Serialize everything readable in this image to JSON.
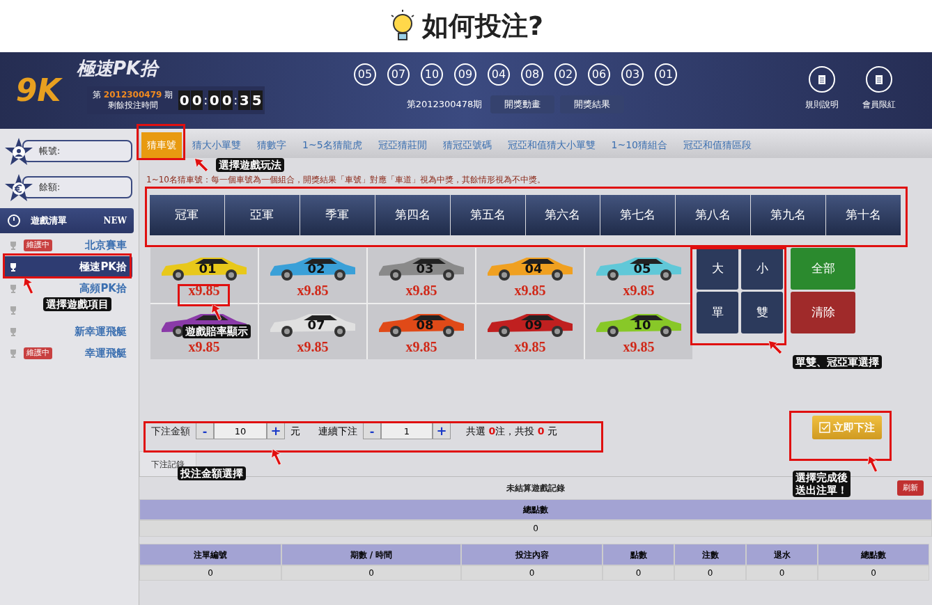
{
  "page_title": "如何投注?",
  "header": {
    "logo": "9K",
    "game_title": "極速PK拾",
    "period_prefix": "第",
    "period": "2012300479",
    "period_suffix": "期",
    "countdown_label": "剩餘投注時間",
    "countdown": [
      "0",
      "0",
      ":",
      "0",
      "0",
      ":",
      "3",
      "5"
    ],
    "draw_numbers": [
      "05",
      "07",
      "10",
      "09",
      "04",
      "08",
      "02",
      "06",
      "03",
      "01"
    ],
    "last_period": "第2012300478期",
    "buttons": [
      "開獎動畫",
      "開獎結果"
    ],
    "links": [
      "規則說明",
      "會員限紅"
    ]
  },
  "sidebar": {
    "fields": [
      {
        "label": "帳號:",
        "kind": "user"
      },
      {
        "label": "餘額:",
        "kind": "euro"
      }
    ],
    "menu_title": "遊戲清單",
    "menu_badge": "NEW",
    "games": [
      {
        "name": "北京賽車",
        "badge": "維護中",
        "selected": false
      },
      {
        "name": "極速PK拾",
        "selected": true
      },
      {
        "name": "高頻PK拾",
        "selected": false
      },
      {
        "selected": false
      },
      {
        "name": "新幸運飛艇",
        "selected": false
      },
      {
        "name": "幸運飛艇",
        "badge": "維護中",
        "selected": false
      }
    ]
  },
  "tabs": [
    {
      "label": "猜車號",
      "selected": true
    },
    {
      "label": "猜大小單雙",
      "selected": false
    },
    {
      "label": "猜數字",
      "selected": false
    },
    {
      "label": "1~5名猜龍虎",
      "selected": false
    },
    {
      "label": "冠亞猜莊閒",
      "selected": false
    },
    {
      "label": "猜冠亞號碼",
      "selected": false
    },
    {
      "label": "冠亞和值猜大小單雙",
      "selected": false
    },
    {
      "label": "1~10猜組合",
      "selected": false
    },
    {
      "label": "冠亞和值猜區段",
      "selected": false
    }
  ],
  "description": "1~10名猜車號：每一個車號為一個組合，開獎結果「車號」對應「車道」視為中獎，其餘情形視為不中獎。",
  "positions": [
    "冠軍",
    "亞軍",
    "季軍",
    "第四名",
    "第五名",
    "第六名",
    "第七名",
    "第八名",
    "第九名",
    "第十名"
  ],
  "cars": [
    {
      "number": "01",
      "color": "#e8c81a",
      "odds": "x9.85"
    },
    {
      "number": "02",
      "color": "#3aa0d8",
      "odds": "x9.85"
    },
    {
      "number": "03",
      "color": "#8a8a8a",
      "odds": "x9.85"
    },
    {
      "number": "04",
      "color": "#f0a020",
      "odds": "x9.85"
    },
    {
      "number": "05",
      "color": "#60c8d8",
      "odds": "x9.85"
    },
    {
      "color": "#8a3aa8",
      "odds": "x9.85"
    },
    {
      "number": "07",
      "color": "#e0e0e0",
      "odds": "x9.85"
    },
    {
      "number": "08",
      "color": "#e04a18",
      "odds": "x9.85"
    },
    {
      "number": "09",
      "color": "#c02020",
      "odds": "x9.85"
    },
    {
      "number": "10",
      "color": "#88c828",
      "odds": "x9.85"
    }
  ],
  "quick_buttons": [
    {
      "label": "大",
      "kind": "pick"
    },
    {
      "label": "小",
      "kind": "pick"
    },
    {
      "label": "全部",
      "kind": "all"
    },
    {
      "label": "單",
      "kind": "pick"
    },
    {
      "label": "雙",
      "kind": "pick"
    },
    {
      "label": "清除",
      "kind": "clear"
    }
  ],
  "bet_bar": {
    "amount_label": "下注金額",
    "minus": "-",
    "amount": "10",
    "plus": "+",
    "unit": "元",
    "repeat_label": "連續下注",
    "repeat": "1",
    "summary": [
      {
        "text": "共選 ",
        "kind": "plain"
      },
      {
        "text": "0",
        "kind": "count"
      },
      {
        "text": "注，共投 ",
        "kind": "plain"
      },
      {
        "text": "0",
        "kind": "count"
      },
      {
        "text": " 元",
        "kind": "plain"
      }
    ]
  },
  "submit": "立即下注",
  "records": {
    "tab": "下注記錄",
    "title": "未結算遊戲記錄",
    "refresh": "刷新",
    "total_header": "總點數",
    "total_value": "0",
    "columns": [
      "注單編號",
      "期數 / 時間",
      "投注內容",
      "點數",
      "注數",
      "退水",
      "總點數"
    ],
    "row": [
      "0",
      "0",
      "0",
      "0",
      "0",
      "0",
      "0"
    ]
  },
  "annotations": [
    {
      "lines": [
        "選擇遊戲玩法"
      ]
    },
    {
      "lines": [
        "選擇遊戲項目"
      ]
    },
    {
      "lines": [
        "遊戲賠率顯示"
      ]
    },
    {
      "lines": [
        "單雙、冠亞軍選擇"
      ]
    },
    {
      "lines": [
        "投注金額選擇"
      ]
    },
    {
      "lines": [
        "選擇完成後",
        "送出注單！"
      ]
    }
  ]
}
